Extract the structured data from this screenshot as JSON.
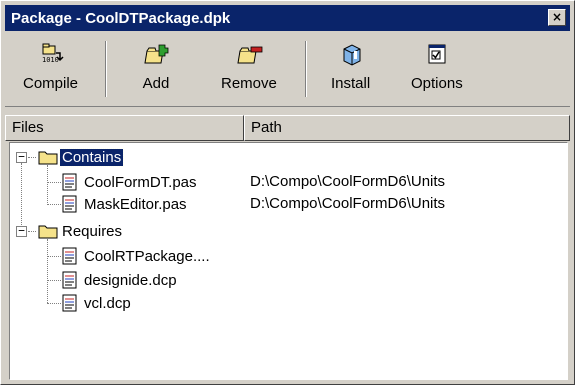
{
  "window": {
    "title": "Package - CoolDTPackage.dpk",
    "close_glyph": "×"
  },
  "toolbar": {
    "buttons": [
      {
        "label": "Compile",
        "icon": "compile-icon"
      },
      {
        "label": "Add",
        "icon": "add-icon"
      },
      {
        "label": "Remove",
        "icon": "remove-icon"
      },
      {
        "label": "Install",
        "icon": "install-icon"
      },
      {
        "label": "Options",
        "icon": "options-icon"
      }
    ]
  },
  "columns": {
    "files": "Files",
    "path": "Path"
  },
  "tree": {
    "contains": {
      "label": "Contains",
      "expander": "−",
      "items": [
        {
          "name": "CoolFormDT.pas",
          "path": "D:\\Compo\\CoolFormD6\\Units"
        },
        {
          "name": "MaskEditor.pas",
          "path": "D:\\Compo\\CoolFormD6\\Units"
        }
      ]
    },
    "requires": {
      "label": "Requires",
      "expander": "−",
      "items": [
        {
          "name": "CoolRTPackage...."
        },
        {
          "name": "designide.dcp"
        },
        {
          "name": "vcl.dcp"
        }
      ]
    }
  },
  "colors": {
    "titlebar": "#0a246a",
    "face": "#d4d0c8",
    "selection": "#0a246a",
    "folder": "#f5e28a"
  }
}
